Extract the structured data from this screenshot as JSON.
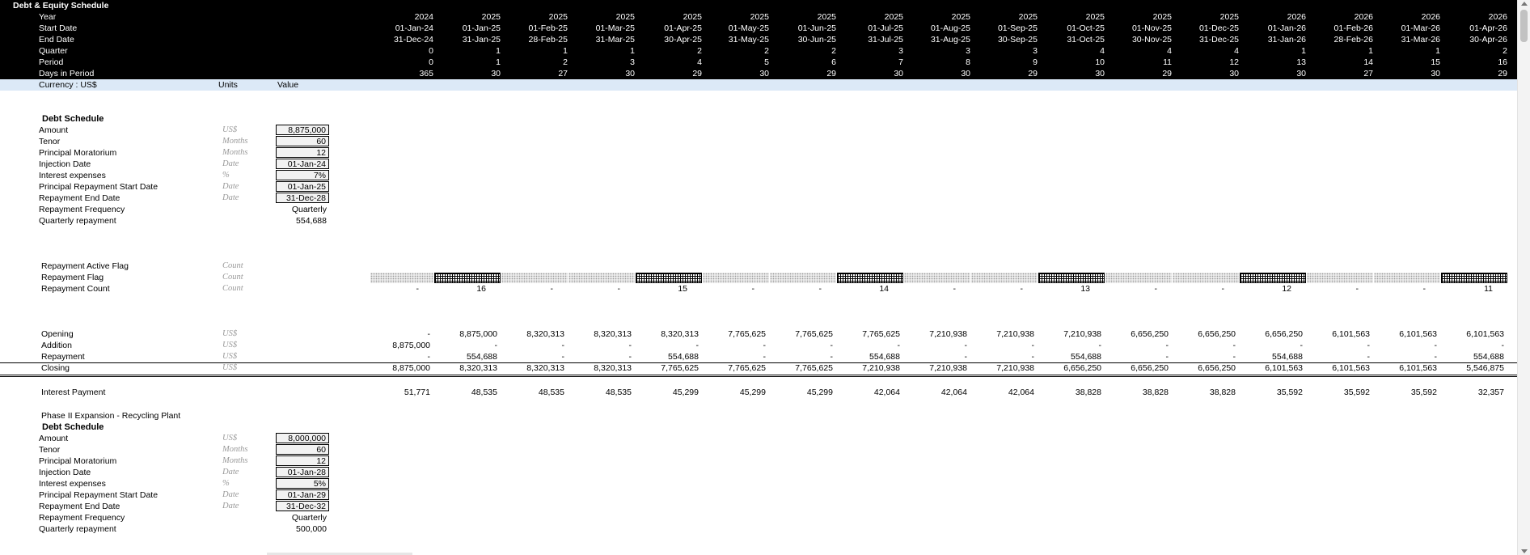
{
  "title": "Debt & Equity Schedule",
  "timeline": {
    "labels": [
      "Year",
      "Start Date",
      "End Date",
      "Quarter",
      "Period",
      "Days in Period"
    ],
    "year": [
      "2024",
      "2025",
      "2025",
      "2025",
      "2025",
      "2025",
      "2025",
      "2025",
      "2025",
      "2025",
      "2025",
      "2025",
      "2025",
      "2026",
      "2026",
      "2026",
      "2026"
    ],
    "start": [
      "01-Jan-24",
      "01-Jan-25",
      "01-Feb-25",
      "01-Mar-25",
      "01-Apr-25",
      "01-May-25",
      "01-Jun-25",
      "01-Jul-25",
      "01-Aug-25",
      "01-Sep-25",
      "01-Oct-25",
      "01-Nov-25",
      "01-Dec-25",
      "01-Jan-26",
      "01-Feb-26",
      "01-Mar-26",
      "01-Apr-26"
    ],
    "end": [
      "31-Dec-24",
      "31-Jan-25",
      "28-Feb-25",
      "31-Mar-25",
      "30-Apr-25",
      "31-May-25",
      "30-Jun-25",
      "31-Jul-25",
      "31-Aug-25",
      "30-Sep-25",
      "31-Oct-25",
      "30-Nov-25",
      "31-Dec-25",
      "31-Jan-26",
      "28-Feb-26",
      "31-Mar-26",
      "30-Apr-26"
    ],
    "quarter": [
      "0",
      "1",
      "1",
      "1",
      "2",
      "2",
      "2",
      "3",
      "3",
      "3",
      "4",
      "4",
      "4",
      "1",
      "1",
      "1",
      "2"
    ],
    "period": [
      "0",
      "1",
      "2",
      "3",
      "4",
      "5",
      "6",
      "7",
      "8",
      "9",
      "10",
      "11",
      "12",
      "13",
      "14",
      "15",
      "16"
    ],
    "days": [
      "365",
      "30",
      "27",
      "30",
      "29",
      "30",
      "29",
      "30",
      "30",
      "29",
      "30",
      "29",
      "30",
      "30",
      "27",
      "30",
      "29"
    ]
  },
  "columns_header": {
    "currency": "Currency : US$",
    "units": "Units",
    "value": "Value"
  },
  "debt1": {
    "heading": "Debt Schedule",
    "inputs": [
      {
        "label": "Amount",
        "unit": "US$",
        "value": "8,875,000",
        "boxed": true
      },
      {
        "label": "Tenor",
        "unit": "Months",
        "value": "60",
        "boxed": true
      },
      {
        "label": "Principal Moratorium",
        "unit": "Months",
        "value": "12",
        "boxed": true
      },
      {
        "label": "Injection Date",
        "unit": "Date",
        "value": "01-Jan-24",
        "boxed": true
      },
      {
        "label": "Interest expenses",
        "unit": "%",
        "value": "7%",
        "boxed": true
      },
      {
        "label": "Principal Repayment Start Date",
        "unit": "Date",
        "value": "01-Jan-25",
        "boxed": true
      },
      {
        "label": "Repayment End Date",
        "unit": "Date",
        "value": "31-Dec-28",
        "boxed": true
      },
      {
        "label": "Repayment Frequency",
        "unit": "",
        "value": "Quarterly",
        "boxed": false
      },
      {
        "label": "Quarterly repayment",
        "unit": "",
        "value": "554,688",
        "boxed": false
      }
    ],
    "flags": {
      "active_label": "Repayment Active Flag",
      "flag_label": "Repayment Flag",
      "count_label": "Repayment Count",
      "unit": "Count",
      "pattern": [
        "dot",
        "grid",
        "dot",
        "dot",
        "grid",
        "dot",
        "dot",
        "grid",
        "dot",
        "dot",
        "grid",
        "dot",
        "dot",
        "grid",
        "dot",
        "dot",
        "grid"
      ],
      "count": [
        "-",
        "16",
        "-",
        "-",
        "15",
        "-",
        "-",
        "14",
        "-",
        "-",
        "13",
        "-",
        "-",
        "12",
        "-",
        "-",
        "11"
      ]
    },
    "balance": [
      {
        "label": "Opening",
        "unit": "US$",
        "values": [
          "-",
          "8,875,000",
          "8,320,313",
          "8,320,313",
          "8,320,313",
          "7,765,625",
          "7,765,625",
          "7,765,625",
          "7,210,938",
          "7,210,938",
          "7,210,938",
          "6,656,250",
          "6,656,250",
          "6,656,250",
          "6,101,563",
          "6,101,563",
          "6,101,563"
        ]
      },
      {
        "label": "Addition",
        "unit": "US$",
        "values": [
          "8,875,000",
          "-",
          "-",
          "-",
          "-",
          "-",
          "-",
          "-",
          "-",
          "-",
          "-",
          "-",
          "-",
          "-",
          "-",
          "-",
          "-"
        ]
      },
      {
        "label": "Repayment",
        "unit": "US$",
        "values": [
          "-",
          "554,688",
          "-",
          "-",
          "554,688",
          "-",
          "-",
          "554,688",
          "-",
          "-",
          "554,688",
          "-",
          "-",
          "554,688",
          "-",
          "-",
          "554,688"
        ]
      },
      {
        "label": "Closing",
        "unit": "US$",
        "values": [
          "8,875,000",
          "8,320,313",
          "8,320,313",
          "8,320,313",
          "7,765,625",
          "7,765,625",
          "7,765,625",
          "7,210,938",
          "7,210,938",
          "7,210,938",
          "6,656,250",
          "6,656,250",
          "6,656,250",
          "6,101,563",
          "6,101,563",
          "6,101,563",
          "5,546,875"
        ]
      }
    ],
    "interest": {
      "label": "Interest Payment",
      "values": [
        "51,771",
        "48,535",
        "48,535",
        "48,535",
        "45,299",
        "45,299",
        "45,299",
        "42,064",
        "42,064",
        "42,064",
        "38,828",
        "38,828",
        "38,828",
        "35,592",
        "35,592",
        "35,592",
        "32,357"
      ]
    }
  },
  "debt2": {
    "subtitle": "Phase II Expansion - Recycling Plant",
    "heading": "Debt Schedule",
    "inputs": [
      {
        "label": "Amount",
        "unit": "US$",
        "value": "8,000,000",
        "boxed": true
      },
      {
        "label": "Tenor",
        "unit": "Months",
        "value": "60",
        "boxed": true
      },
      {
        "label": "Principal Moratorium",
        "unit": "Months",
        "value": "12",
        "boxed": true
      },
      {
        "label": "Injection Date",
        "unit": "Date",
        "value": "01-Jan-28",
        "boxed": true
      },
      {
        "label": "Interest expenses",
        "unit": "%",
        "value": "5%",
        "boxed": true
      },
      {
        "label": "Principal Repayment Start Date",
        "unit": "Date",
        "value": "01-Jan-29",
        "boxed": true
      },
      {
        "label": "Repayment End Date",
        "unit": "Date",
        "value": "31-Dec-32",
        "boxed": true
      },
      {
        "label": "Repayment Frequency",
        "unit": "",
        "value": "Quarterly",
        "boxed": false
      },
      {
        "label": "Quarterly repayment",
        "unit": "",
        "value": "500,000",
        "boxed": false
      }
    ]
  }
}
